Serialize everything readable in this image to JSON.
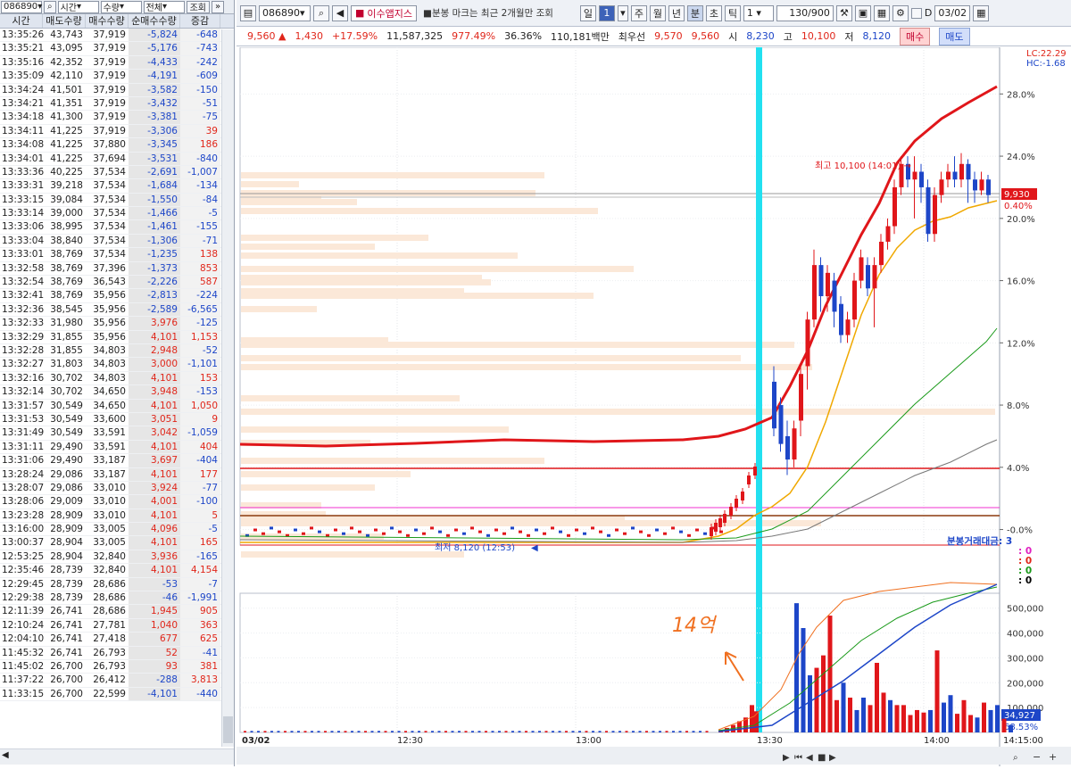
{
  "left_panel": {
    "code": "086890",
    "time_select": "시간",
    "qty_select": "수량",
    "all_select": "전체",
    "query_btn": "조회",
    "headers": [
      "시간",
      "매도수량",
      "매수수량",
      "순매수수량",
      "증감"
    ],
    "rows": [
      [
        "13:35:26",
        "43,743",
        "37,919",
        "-5,824",
        "-648"
      ],
      [
        "13:35:21",
        "43,095",
        "37,919",
        "-5,176",
        "-743"
      ],
      [
        "13:35:16",
        "42,352",
        "37,919",
        "-4,433",
        "-242"
      ],
      [
        "13:35:09",
        "42,110",
        "37,919",
        "-4,191",
        "-609"
      ],
      [
        "13:34:24",
        "41,501",
        "37,919",
        "-3,582",
        "-150"
      ],
      [
        "13:34:21",
        "41,351",
        "37,919",
        "-3,432",
        "-51"
      ],
      [
        "13:34:18",
        "41,300",
        "37,919",
        "-3,381",
        "-75"
      ],
      [
        "13:34:11",
        "41,225",
        "37,919",
        "-3,306",
        "39"
      ],
      [
        "13:34:08",
        "41,225",
        "37,880",
        "-3,345",
        "186"
      ],
      [
        "13:34:01",
        "41,225",
        "37,694",
        "-3,531",
        "-840"
      ],
      [
        "13:33:36",
        "40,225",
        "37,534",
        "-2,691",
        "-1,007"
      ],
      [
        "13:33:31",
        "39,218",
        "37,534",
        "-1,684",
        "-134"
      ],
      [
        "13:33:15",
        "39,084",
        "37,534",
        "-1,550",
        "-84"
      ],
      [
        "13:33:14",
        "39,000",
        "37,534",
        "-1,466",
        "-5"
      ],
      [
        "13:33:06",
        "38,995",
        "37,534",
        "-1,461",
        "-155"
      ],
      [
        "13:33:04",
        "38,840",
        "37,534",
        "-1,306",
        "-71"
      ],
      [
        "13:33:01",
        "38,769",
        "37,534",
        "-1,235",
        "138"
      ],
      [
        "13:32:58",
        "38,769",
        "37,396",
        "-1,373",
        "853"
      ],
      [
        "13:32:54",
        "38,769",
        "36,543",
        "-2,226",
        "587"
      ],
      [
        "13:32:41",
        "38,769",
        "35,956",
        "-2,813",
        "-224"
      ],
      [
        "13:32:36",
        "38,545",
        "35,956",
        "-2,589",
        "-6,565"
      ],
      [
        "13:32:33",
        "31,980",
        "35,956",
        "3,976",
        "-125"
      ],
      [
        "13:32:29",
        "31,855",
        "35,956",
        "4,101",
        "1,153"
      ],
      [
        "13:32:28",
        "31,855",
        "34,803",
        "2,948",
        "-52"
      ],
      [
        "13:32:27",
        "31,803",
        "34,803",
        "3,000",
        "-1,101"
      ],
      [
        "13:32:16",
        "30,702",
        "34,803",
        "4,101",
        "153"
      ],
      [
        "13:32:14",
        "30,702",
        "34,650",
        "3,948",
        "-153"
      ],
      [
        "13:31:57",
        "30,549",
        "34,650",
        "4,101",
        "1,050"
      ],
      [
        "13:31:53",
        "30,549",
        "33,600",
        "3,051",
        "9"
      ],
      [
        "13:31:49",
        "30,549",
        "33,591",
        "3,042",
        "-1,059"
      ],
      [
        "13:31:11",
        "29,490",
        "33,591",
        "4,101",
        "404"
      ],
      [
        "13:31:06",
        "29,490",
        "33,187",
        "3,697",
        "-404"
      ],
      [
        "13:28:24",
        "29,086",
        "33,187",
        "4,101",
        "177"
      ],
      [
        "13:28:07",
        "29,086",
        "33,010",
        "3,924",
        "-77"
      ],
      [
        "13:28:06",
        "29,009",
        "33,010",
        "4,001",
        "-100"
      ],
      [
        "13:23:28",
        "28,909",
        "33,010",
        "4,101",
        "5"
      ],
      [
        "13:16:00",
        "28,909",
        "33,005",
        "4,096",
        "-5"
      ],
      [
        "13:00:37",
        "28,904",
        "33,005",
        "4,101",
        "165"
      ],
      [
        "12:53:25",
        "28,904",
        "32,840",
        "3,936",
        "-165"
      ],
      [
        "12:35:46",
        "28,739",
        "32,840",
        "4,101",
        "4,154"
      ],
      [
        "12:29:45",
        "28,739",
        "28,686",
        "-53",
        "-7"
      ],
      [
        "12:29:38",
        "28,739",
        "28,686",
        "-46",
        "-1,991"
      ],
      [
        "12:11:39",
        "26,741",
        "28,686",
        "1,945",
        "905"
      ],
      [
        "12:10:24",
        "26,741",
        "27,781",
        "1,040",
        "363"
      ],
      [
        "12:04:10",
        "26,741",
        "27,418",
        "677",
        "625"
      ],
      [
        "11:45:32",
        "26,741",
        "26,793",
        "52",
        "-41"
      ],
      [
        "11:45:02",
        "26,700",
        "26,793",
        "93",
        "381"
      ],
      [
        "11:37:22",
        "26,700",
        "26,412",
        "-288",
        "3,813"
      ],
      [
        "11:33:15",
        "26,700",
        "22,599",
        "-4,101",
        "-440"
      ]
    ]
  },
  "toolbar": {
    "code": "086890",
    "stock_name": "이수앱지스",
    "notice": "분봉 마크는 최근 2개월만 조회",
    "periods": [
      "일",
      "1",
      "주",
      "월",
      "년",
      "분",
      "초",
      "틱"
    ],
    "interval": "1",
    "count": "130/900",
    "date": "03/02",
    "d_label": "D"
  },
  "quote": {
    "price": "9,560",
    "change": "1,430",
    "change_pct": "+17.59%",
    "volume": "11,587,325",
    "vol_ratio": "977.49%",
    "turnover": "36.36%",
    "amount": "110,181백만",
    "best_label": "최우선",
    "ask": "9,570",
    "bid": "9,560",
    "open_label": "시",
    "open": "8,230",
    "high_label": "고",
    "high": "10,100",
    "low_label": "저",
    "low": "8,120",
    "buy_btn": "매수",
    "sell_btn": "매도"
  },
  "chart_data": {
    "type": "candlestick",
    "x_labels": [
      "03/02",
      "12:30",
      "13:00",
      "13:30",
      "14:00",
      "14:15:00"
    ],
    "price_axis": [
      "28.0%",
      "24.0%",
      "20.0%",
      "16.0%",
      "12.0%",
      "8.0%",
      "4.0%",
      "-0.0%"
    ],
    "price_axis_range_pct": [
      -1,
      31
    ],
    "lc_label": "LC:22.29",
    "hc_label": "HC:-1.68",
    "current_price_tag": "9,930",
    "current_pct_tag": "0.40%",
    "high_annotation": "최고 10,100 (14:01)",
    "low_annotation": "최저 8,120 (12:53)",
    "transaction_label": "분봉거래대금",
    "transaction_values": [
      "3",
      "0",
      "0",
      "0",
      "0"
    ],
    "transaction_colors": [
      "#1d46c8",
      "#e020c0",
      "#e0261a",
      "#1a9a1a",
      "#000000"
    ],
    "volume_axis": [
      "500,000",
      "400,000",
      "300,000",
      "200,000",
      "100,000"
    ],
    "volume_axis_range": [
      0,
      560000
    ],
    "current_volume_tag": "34,927",
    "volume_pct_tag": "68.53%",
    "handwritten_note": "14억",
    "candles_pct": [
      [
        9.5,
        6.5,
        10.5,
        6.0
      ],
      [
        8.0,
        5.5,
        8.5,
        5.0
      ],
      [
        6.0,
        4.5,
        7.0,
        3.5
      ],
      [
        4.5,
        6.5,
        7.0,
        4.0
      ],
      [
        7.0,
        10.0,
        10.5,
        6.0
      ],
      [
        10.5,
        13.5,
        14.0,
        9.0
      ],
      [
        13.5,
        17.0,
        18.0,
        13.0
      ],
      [
        17.0,
        15.0,
        17.5,
        14.0
      ],
      [
        15.0,
        16.5,
        17.0,
        14.0
      ],
      [
        16.0,
        14.0,
        16.5,
        13.0
      ],
      [
        14.5,
        12.5,
        15.0,
        12.0
      ],
      [
        12.5,
        13.5,
        14.0,
        12.0
      ],
      [
        13.5,
        16.0,
        16.5,
        13.0
      ],
      [
        16.0,
        17.5,
        18.0,
        15.5
      ],
      [
        17.0,
        15.5,
        17.5,
        15.0
      ],
      [
        15.5,
        17.0,
        17.5,
        13.0
      ],
      [
        17.0,
        18.5,
        19.0,
        16.5
      ],
      [
        18.5,
        19.5,
        20.0,
        18.0
      ],
      [
        19.5,
        22.0,
        22.5,
        19.0
      ],
      [
        22.0,
        23.5,
        24.0,
        21.5
      ],
      [
        23.5,
        22.5,
        24.0,
        22.0
      ],
      [
        22.5,
        23.0,
        24.0,
        20.0
      ],
      [
        23.0,
        22.0,
        23.5,
        21.0
      ],
      [
        22.0,
        19.0,
        22.5,
        18.5
      ],
      [
        19.0,
        21.5,
        22.0,
        18.5
      ],
      [
        21.5,
        22.5,
        23.0,
        21.0
      ],
      [
        22.5,
        23.0,
        23.5,
        22.0
      ],
      [
        23.0,
        22.5,
        24.0,
        22.0
      ],
      [
        22.5,
        23.5,
        24.2,
        22.0
      ],
      [
        23.5,
        22.5,
        23.8,
        21.0
      ],
      [
        22.5,
        21.8,
        23.0,
        21.0
      ],
      [
        21.8,
        22.5,
        23.0,
        21.5
      ],
      [
        22.5,
        21.5,
        22.8,
        21.0
      ]
    ],
    "volumes": [
      520000,
      420000,
      230000,
      260000,
      310000,
      470000,
      130000,
      200000,
      140000,
      90000,
      140000,
      110000,
      280000,
      160000,
      130000,
      110000,
      110000,
      70000,
      90000,
      80000,
      90000,
      330000,
      120000,
      150000,
      75000,
      130000,
      70000,
      60000,
      120000,
      90000,
      110000,
      55000,
      30000
    ],
    "series": [
      {
        "name": "upper-band",
        "color": "#e0161a"
      },
      {
        "name": "ma-short",
        "color": "#f0a800"
      },
      {
        "name": "ma-mid",
        "color": "#1a9a1a"
      },
      {
        "name": "ma-long",
        "color": "#777777"
      }
    ]
  }
}
